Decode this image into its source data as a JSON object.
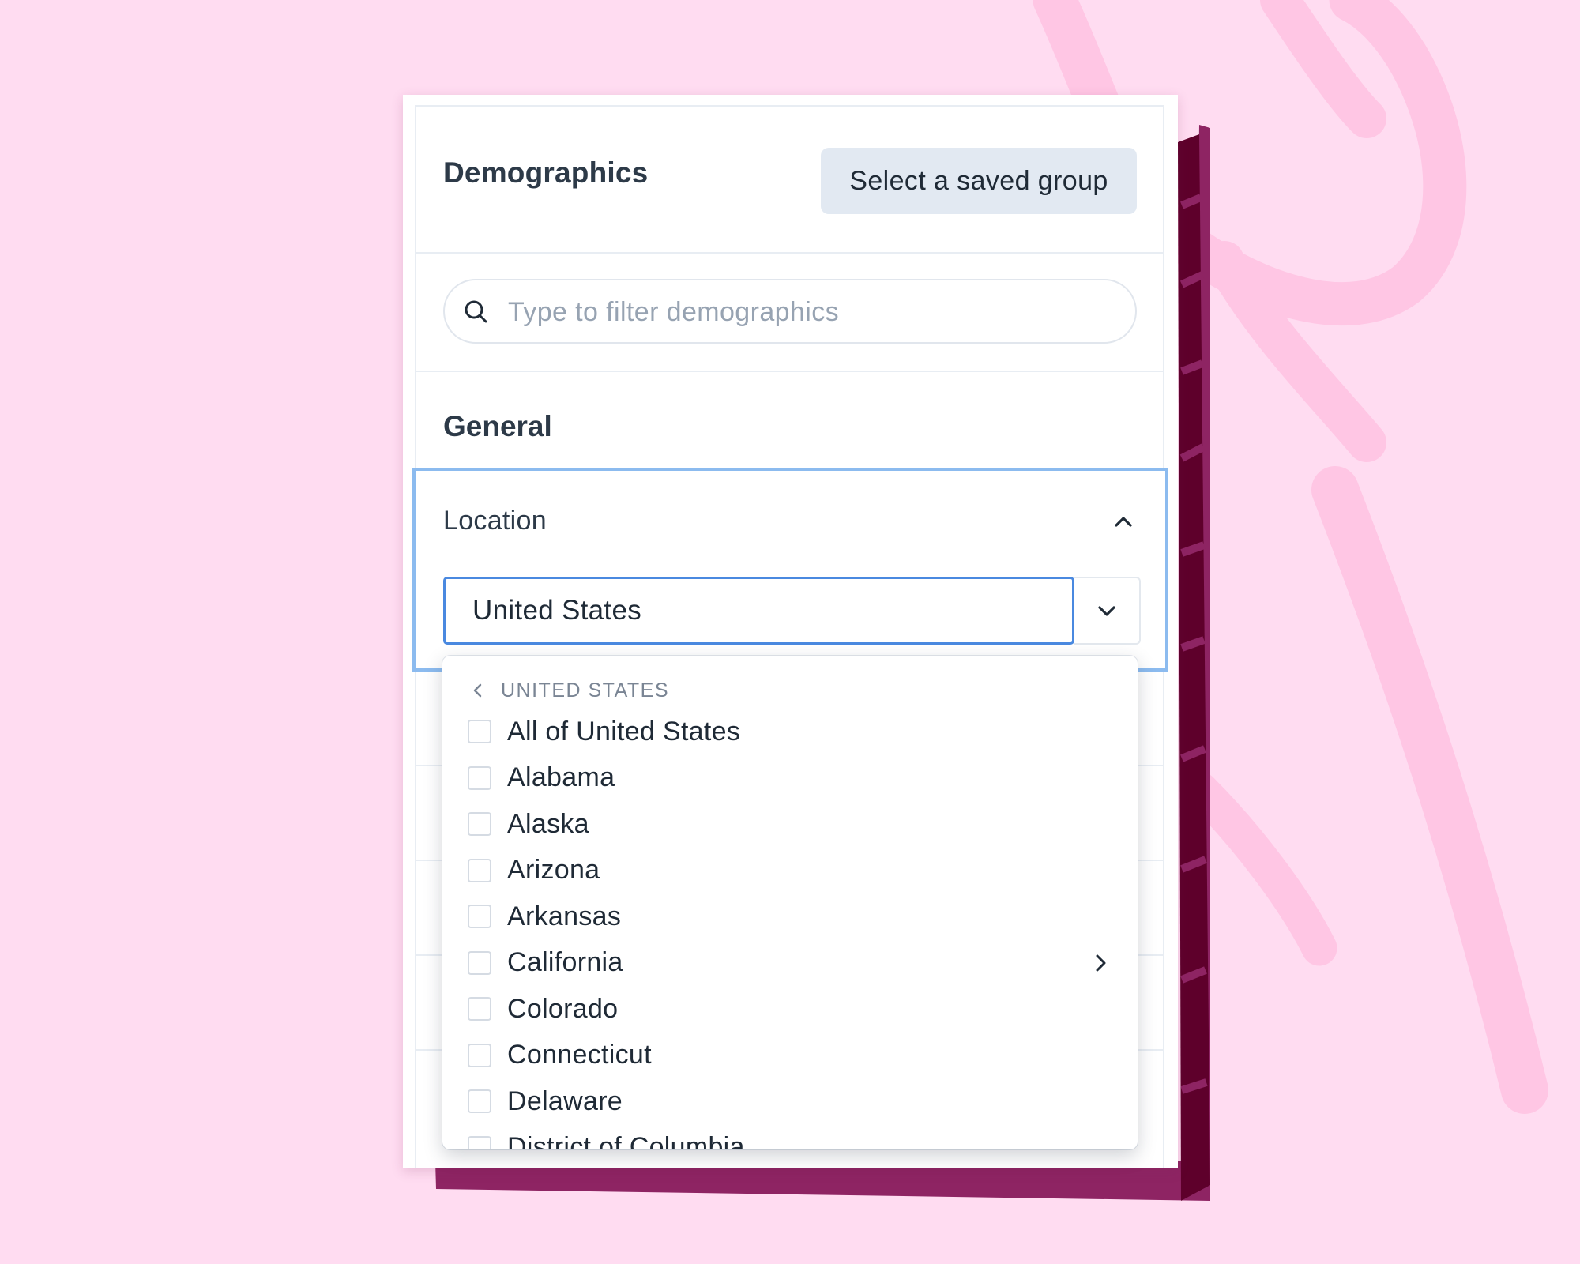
{
  "panel": {
    "title": "Demographics",
    "saved_group_button": "Select a saved group",
    "search_placeholder": "Type to filter demographics",
    "section_title": "General"
  },
  "location": {
    "label": "Location",
    "selected_value": "United States"
  },
  "dropdown": {
    "breadcrumb": "UNITED STATES",
    "options": [
      {
        "label": "All of United States",
        "checked": false,
        "has_children": false
      },
      {
        "label": "Alabama",
        "checked": false,
        "has_children": false
      },
      {
        "label": "Alaska",
        "checked": false,
        "has_children": false
      },
      {
        "label": "Arizona",
        "checked": false,
        "has_children": false
      },
      {
        "label": "Arkansas",
        "checked": false,
        "has_children": false
      },
      {
        "label": "California",
        "checked": false,
        "has_children": true
      },
      {
        "label": "Colorado",
        "checked": false,
        "has_children": false
      },
      {
        "label": "Connecticut",
        "checked": false,
        "has_children": false
      },
      {
        "label": "Delaware",
        "checked": false,
        "has_children": false
      },
      {
        "label": "District of Columbia",
        "checked": false,
        "has_children": false
      }
    ]
  },
  "colors": {
    "background": "#ffdcf1",
    "backing_card": "#8e2463",
    "backing_shadow": "#5e002b",
    "focus_outline": "#8cbbef",
    "input_focus": "#4a89e0",
    "button_bg": "#e2e9f2"
  },
  "icons": {
    "search": "search-icon",
    "collapse": "chevron-up-icon",
    "toggle": "chevron-down-icon",
    "back": "chevron-left-icon",
    "expand": "chevron-right-icon"
  }
}
